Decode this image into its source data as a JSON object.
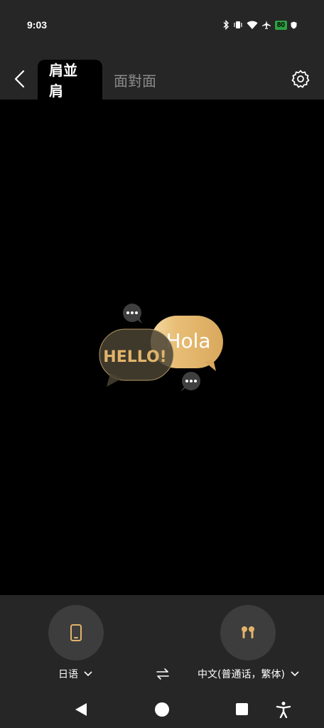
{
  "status_bar": {
    "time": "9:03",
    "battery_level": "80",
    "icons": [
      "bluetooth-icon",
      "vibrate-icon",
      "wifi-icon",
      "airplane-icon",
      "battery-icon",
      "shield-icon"
    ]
  },
  "header": {
    "tabs": [
      {
        "label": "肩並肩",
        "active": true
      },
      {
        "label": "面對面",
        "active": false
      }
    ],
    "icons": [
      "back-arrow-icon",
      "settings-gear-icon"
    ]
  },
  "illustration": {
    "bubble_left_text": "HELLO!",
    "bubble_right_text": "Hola"
  },
  "bottom": {
    "left_device_icon": "phone-icon",
    "right_device_icon": "earbuds-icon",
    "left_language": "日语",
    "right_language": "中文(普通话，繁体)",
    "swap_icon": "swap-arrows-icon"
  },
  "colors": {
    "accent_gold": "#e2b46a",
    "bar_background": "#262626",
    "button_background": "#3d3d3d"
  },
  "nav_bar": {
    "icons": [
      "back-triangle-icon",
      "home-circle-icon",
      "recents-square-icon",
      "accessibility-icon"
    ]
  }
}
